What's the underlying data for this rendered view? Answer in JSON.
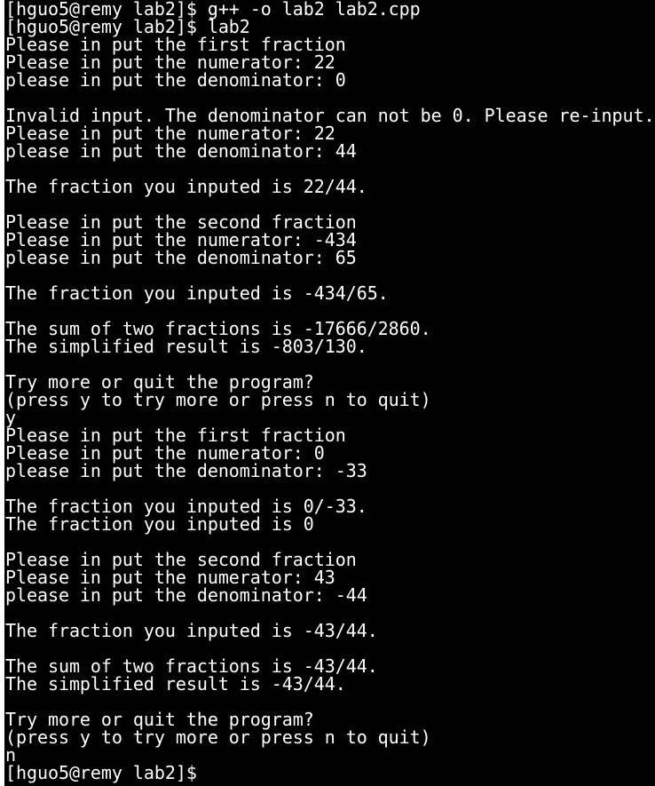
{
  "terminal": {
    "lines": [
      "[hguo5@remy lab2]$ g++ -o lab2 lab2.cpp",
      "[hguo5@remy lab2]$ lab2",
      "Please in put the first fraction",
      "Please in put the numerator: 22",
      "please in put the denominator: 0",
      "",
      "Invalid input. The denominator can not be 0. Please re-input.",
      "Please in put the numerator: 22",
      "please in put the denominator: 44",
      "",
      "The fraction you inputed is 22/44.",
      "",
      "Please in put the second fraction",
      "Please in put the numerator: -434",
      "please in put the denominator: 65",
      "",
      "The fraction you inputed is -434/65.",
      "",
      "The sum of two fractions is -17666/2860.",
      "The simplified result is -803/130.",
      "",
      "Try more or quit the program?",
      "(press y to try more or press n to quit)",
      "y",
      "Please in put the first fraction",
      "Please in put the numerator: 0",
      "please in put the denominator: -33",
      "",
      "The fraction you inputed is 0/-33.",
      "The fraction you inputed is 0",
      "",
      "Please in put the second fraction",
      "Please in put the numerator: 43",
      "please in put the denominator: -44",
      "",
      "The fraction you inputed is -43/44.",
      "",
      "The sum of two fractions is -43/44.",
      "The simplified result is -43/44.",
      "",
      "Try more or quit the program?",
      "(press y to try more or press n to quit)",
      "n",
      "[hguo5@remy lab2]$"
    ]
  }
}
